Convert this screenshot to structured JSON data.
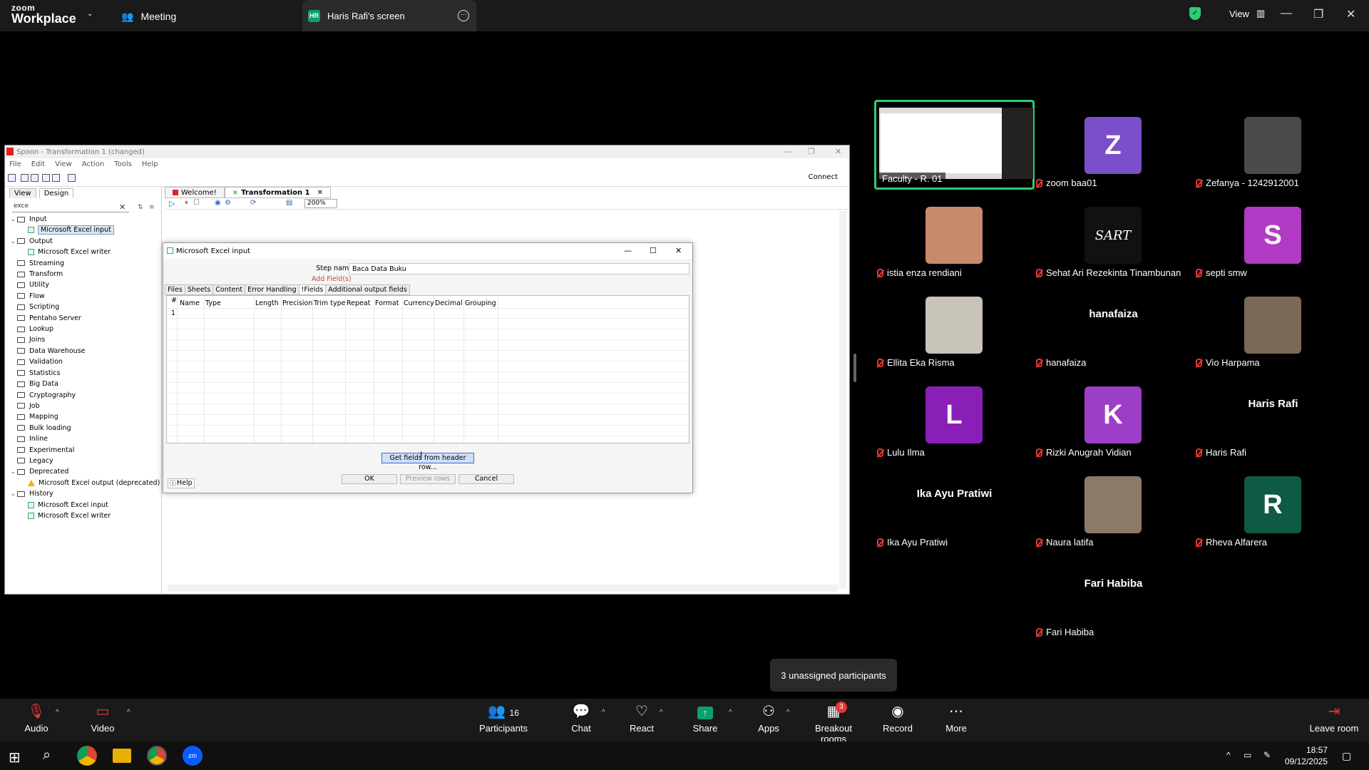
{
  "topbar": {
    "logo_line1": "zoom",
    "logo_line2": "Workplace",
    "meeting_label": "Meeting",
    "share_badge": "HR",
    "share_label": "Haris Rafi's screen",
    "view_label": "View",
    "more_icon": "more-circle-icon"
  },
  "spoon": {
    "title": "Spoon - Transformation 1 (changed)",
    "menu": [
      "File",
      "Edit",
      "View",
      "Action",
      "Tools",
      "Help"
    ],
    "connect": "Connect",
    "left_tabs": [
      "View",
      "Design"
    ],
    "search_value": "exce",
    "tree": [
      {
        "label": "Input",
        "kind": "folder",
        "open": true,
        "depth": 0
      },
      {
        "label": "Microsoft Excel input",
        "kind": "step",
        "depth": 1,
        "selected": true
      },
      {
        "label": "Output",
        "kind": "folder",
        "open": true,
        "depth": 0
      },
      {
        "label": "Microsoft Excel writer",
        "kind": "step",
        "depth": 1
      },
      {
        "label": "Streaming",
        "kind": "folder",
        "depth": 0
      },
      {
        "label": "Transform",
        "kind": "folder",
        "depth": 0
      },
      {
        "label": "Utility",
        "kind": "folder",
        "depth": 0
      },
      {
        "label": "Flow",
        "kind": "folder",
        "depth": 0
      },
      {
        "label": "Scripting",
        "kind": "folder",
        "depth": 0
      },
      {
        "label": "Pentaho Server",
        "kind": "folder",
        "depth": 0
      },
      {
        "label": "Lookup",
        "kind": "folder",
        "depth": 0
      },
      {
        "label": "Joins",
        "kind": "folder",
        "depth": 0
      },
      {
        "label": "Data Warehouse",
        "kind": "folder",
        "depth": 0
      },
      {
        "label": "Validation",
        "kind": "folder",
        "depth": 0
      },
      {
        "label": "Statistics",
        "kind": "folder",
        "depth": 0
      },
      {
        "label": "Big Data",
        "kind": "folder",
        "depth": 0
      },
      {
        "label": "Cryptography",
        "kind": "folder",
        "depth": 0
      },
      {
        "label": "Job",
        "kind": "folder",
        "depth": 0
      },
      {
        "label": "Mapping",
        "kind": "folder",
        "depth": 0
      },
      {
        "label": "Bulk loading",
        "kind": "folder",
        "depth": 0
      },
      {
        "label": "Inline",
        "kind": "folder",
        "depth": 0
      },
      {
        "label": "Experimental",
        "kind": "folder",
        "depth": 0
      },
      {
        "label": "Legacy",
        "kind": "folder",
        "depth": 0
      },
      {
        "label": "Deprecated",
        "kind": "folder",
        "open": true,
        "depth": 0
      },
      {
        "label": "Microsoft Excel output (deprecated)",
        "kind": "warn",
        "depth": 1
      },
      {
        "label": "History",
        "kind": "folder",
        "open": true,
        "depth": 0
      },
      {
        "label": "Microsoft Excel input",
        "kind": "step",
        "depth": 1
      },
      {
        "label": "Microsoft Excel writer",
        "kind": "step",
        "depth": 1
      }
    ],
    "canvas_tabs": [
      "Welcome!",
      "Transformation 1"
    ],
    "zoom": "200%"
  },
  "dialog": {
    "title": "Microsoft Excel input",
    "step_name_label": "Step name",
    "step_name_value": "Baca Data Buku",
    "add_fields": "Add Field(s)",
    "tabs": [
      "Files",
      "Sheets",
      "Content",
      "Error Handling",
      "!Fields",
      "Additional output fields"
    ],
    "active_tab": "!Fields",
    "columns": [
      "#",
      "Name",
      "Type",
      "Length",
      "Precision",
      "Trim type",
      "Repeat",
      "Format",
      "Currency",
      "Decimal",
      "Grouping"
    ],
    "row_numbers": [
      "1"
    ],
    "get_fields": "Get fields from header row...",
    "ok": "OK",
    "preview": "Preview rows",
    "cancel": "Cancel",
    "help": "Help"
  },
  "participants_tiles": [
    {
      "name": "Faculty - R. 01",
      "kind": "screen",
      "muted": false,
      "active": true
    },
    {
      "name": "zoom baa01",
      "kind": "letter",
      "letter": "Z",
      "color": "#7b4fc9",
      "muted": true
    },
    {
      "name": "Zefanya - 1242912001",
      "kind": "photo",
      "color": "#4a4a4a",
      "muted": true
    },
    {
      "name": "istia enza rendiani",
      "kind": "photo",
      "color": "#c88a6c",
      "muted": true
    },
    {
      "name": "Sehat Ari Rezekinta Tinambunan",
      "kind": "photo",
      "color": "#111111",
      "muted": true
    },
    {
      "name": "septi smw",
      "kind": "letter",
      "letter": "S",
      "color": "#b13bc4",
      "muted": true
    },
    {
      "name": "Ellita Eka Risma",
      "kind": "photo",
      "color": "#c9c4b8",
      "muted": true
    },
    {
      "name": "hanafaiza",
      "kind": "text",
      "muted": true
    },
    {
      "name": "Vio Harpama",
      "kind": "photo",
      "color": "#7a6a55",
      "muted": true
    },
    {
      "name": "Lulu Ilma",
      "kind": "letter",
      "letter": "L",
      "color": "#8a1fb8",
      "muted": true
    },
    {
      "name": "Rizki Anugrah Vidian",
      "kind": "letter",
      "letter": "K",
      "color": "#9c3ec6",
      "muted": true
    },
    {
      "name": "Haris Rafi",
      "kind": "text",
      "muted": true
    },
    {
      "name": "Ika Ayu Pratiwi",
      "kind": "text",
      "muted": true
    },
    {
      "name": "Naura latifa",
      "kind": "photo",
      "color": "#8b7a68",
      "muted": true
    },
    {
      "name": "Rheva Alfarera",
      "kind": "letter",
      "letter": "R",
      "color": "#0f5a45",
      "muted": true
    },
    {
      "name": "Fari Habiba",
      "kind": "text",
      "muted": true
    }
  ],
  "tile_overlay_text": {
    "sehat": "SART"
  },
  "tooltip": "3 unassigned participants",
  "toolbar": {
    "audio": "Audio",
    "video": "Video",
    "participants": "Participants",
    "participants_count": "16",
    "chat": "Chat",
    "react": "React",
    "share": "Share",
    "apps": "Apps",
    "breakout": "Breakout rooms",
    "breakout_badge": "3",
    "record": "Record",
    "more": "More",
    "leave": "Leave room"
  },
  "taskbar": {
    "time": "18:57",
    "date": "09/12/2025"
  },
  "colors": {
    "share_green": "#0e9f6e",
    "accent_blue": "#0b5cff",
    "mute_red": "#e53935",
    "active_border": "#2ecc71"
  }
}
